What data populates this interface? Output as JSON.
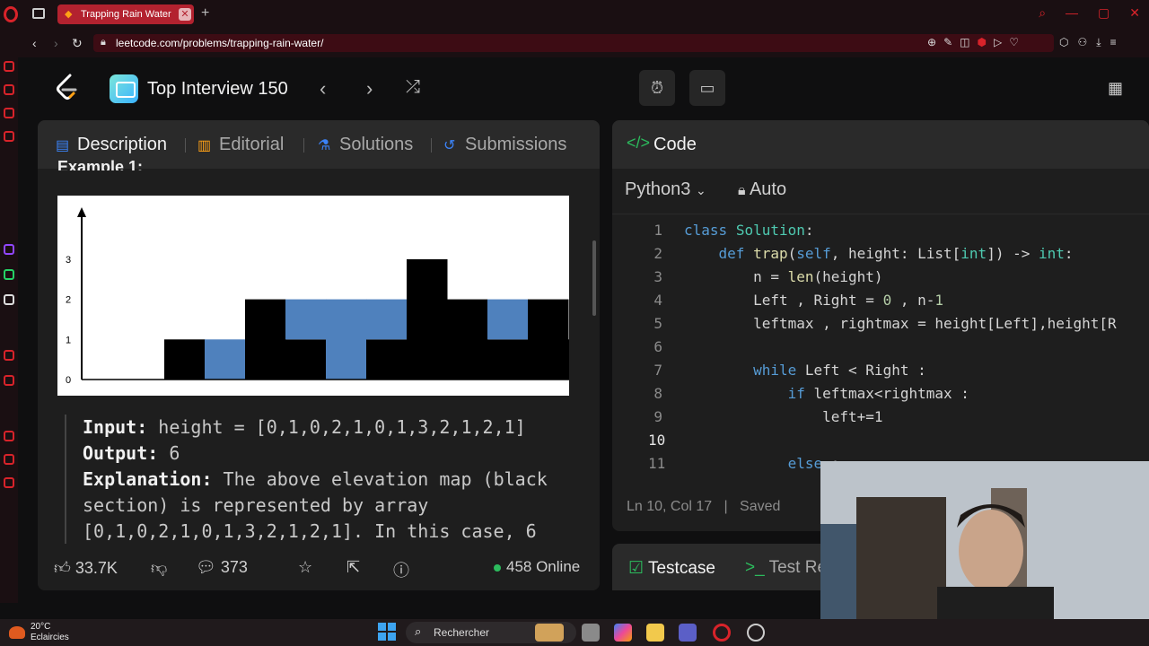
{
  "browser": {
    "tab_title": "Trapping Rain Water",
    "tab_close": "✕",
    "new_tab": "+",
    "url": "leetcode.com/problems/trapping-rain-water/"
  },
  "header": {
    "study_plan_title": "Top Interview 150"
  },
  "left_panel": {
    "tabs": [
      {
        "label": "Description",
        "icon": "document-icon"
      },
      {
        "label": "Editorial",
        "icon": "book-icon"
      },
      {
        "label": "Solutions",
        "icon": "flask-icon"
      },
      {
        "label": "Submissions",
        "icon": "history-icon"
      }
    ],
    "example_heading": "Example 1:",
    "figure": {
      "y_ticks": [
        "0",
        "1",
        "2",
        "3"
      ],
      "heights": [
        0,
        1,
        0,
        2,
        1,
        0,
        1,
        3,
        2,
        1,
        2,
        1
      ],
      "water": [
        0,
        0,
        1,
        0,
        1,
        2,
        1,
        0,
        0,
        1,
        0,
        0
      ],
      "colors": {
        "bar": "#000000",
        "water": "#4f81bd"
      }
    },
    "example": {
      "input_label": "Input:",
      "input_value": "height = [0,1,0,2,1,0,1,3,2,1,2,1]",
      "output_label": "Output:",
      "output_value": "6",
      "explanation_label": "Explanation:",
      "explanation_text": "The above elevation map (black section) is represented by array [0,1,0,2,1,0,1,3,2,1,2,1]. In this case, 6"
    },
    "footer": {
      "likes": "33.7K",
      "comments": "373",
      "online": "458 Online"
    }
  },
  "code_panel": {
    "title": "Code",
    "language": "Python3",
    "auto_label": "Auto",
    "lines": [
      {
        "n": "1",
        "text": "class Solution:"
      },
      {
        "n": "2",
        "text": "    def trap(self, height: List[int]) -> int:"
      },
      {
        "n": "3",
        "text": "        n = len(height)"
      },
      {
        "n": "4",
        "text": "        Left , Right = 0 , n-1"
      },
      {
        "n": "5",
        "text": "        leftmax , rightmax = height[Left],height[R"
      },
      {
        "n": "6",
        "text": ""
      },
      {
        "n": "7",
        "text": "        while Left < Right :"
      },
      {
        "n": "8",
        "text": "            if leftmax<rightmax :"
      },
      {
        "n": "9",
        "text": "                left+=1"
      },
      {
        "n": "10",
        "text": ""
      },
      {
        "n": "11",
        "text": "            else :"
      }
    ],
    "status_position": "Ln 10, Col 17",
    "status_saved": "Saved"
  },
  "testcase_panel": {
    "testcase_label": "Testcase",
    "test_result_label": "Test Re"
  },
  "taskbar": {
    "weather_temp": "20°C",
    "weather_desc": "Eclaircies",
    "search_placeholder": "Rechercher"
  }
}
